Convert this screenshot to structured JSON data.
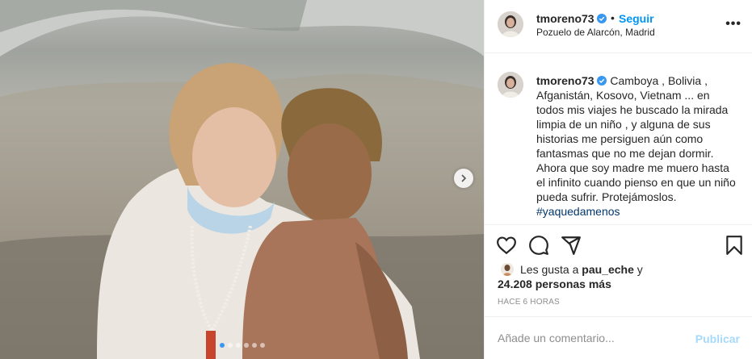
{
  "post": {
    "username": "tmoreno73",
    "verified": true,
    "dot": "•",
    "follow_label": "Seguir",
    "location": "Pozuelo de Alarcón, Madrid"
  },
  "caption": {
    "username": "tmoreno73",
    "text": "Camboya , Bolivia , Afganistán, Kosovo, Vietnam ... en todos mis viajes he buscado la mirada limpia de un niño , y alguna de sus historias me persiguen aún como fantasmas que no me dejan dormir. Ahora que soy madre me muero hasta el infinito cuando pienso en que un niño pueda sufrir. Protejámoslos.",
    "hashtag": "#yaquedamenos"
  },
  "likes": {
    "prefix": "Les gusta a",
    "user": "pau_eche",
    "suffix": "y",
    "count_text": "24.208 personas más"
  },
  "timestamp": "HACE 6 HORAS",
  "comment": {
    "placeholder": "Añade un comentario...",
    "publish_label": "Publicar"
  },
  "carousel": {
    "total": 6,
    "active_index": 0
  },
  "icons": {
    "like": "heart-icon",
    "comment": "comment-icon",
    "share": "share-icon",
    "save": "bookmark-icon",
    "verified": "verified-badge-icon",
    "more": "more-options-icon",
    "next": "chevron-right-icon"
  },
  "colors": {
    "link_blue": "#0095f6",
    "verified_blue": "#3897f0",
    "hashtag": "#00376b",
    "muted": "#8e8e8e",
    "border": "#efefef"
  }
}
